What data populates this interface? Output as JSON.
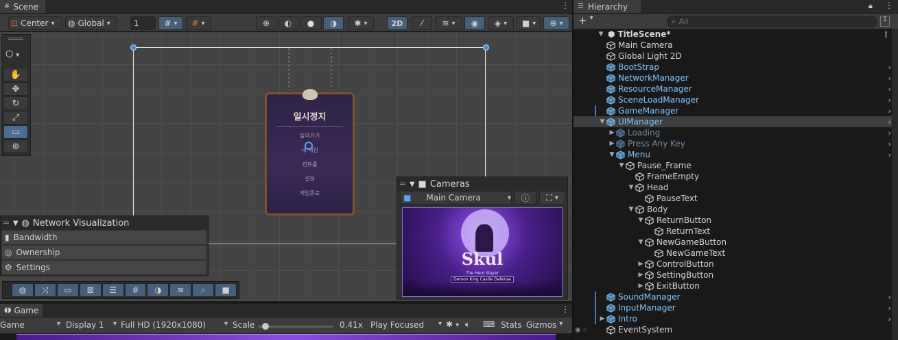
{
  "scene": {
    "tab_label": "Scene",
    "toolbar": {
      "pivot": "Center",
      "space": "Global",
      "grid_size": "1",
      "mode_2d": "2D"
    },
    "cameras_overlay": {
      "title": "Cameras",
      "selected_camera": "Main Camera"
    },
    "network_overlay": {
      "title": "Network Visualization",
      "items": [
        "Bandwidth",
        "Ownership",
        "Settings"
      ]
    },
    "pause_menu": {
      "title": "일시정지",
      "items": [
        "돌아가기",
        "새 게임",
        "컨트롤",
        "설정",
        "게임종료"
      ]
    },
    "preview": {
      "logo": "Skul",
      "subtitle": "The Hero Slayer",
      "banner": "Demon King Castle Defense"
    }
  },
  "game": {
    "tab_label": "Game",
    "view_label": "Game",
    "display": "Display 1",
    "resolution": "Full HD (1920x1080)",
    "scale_label": "Scale",
    "scale_value": "0.41x",
    "scale_fraction": 0.05,
    "play_mode": "Play Focused",
    "stats": "Stats",
    "gizmos": "Gizmos"
  },
  "hierarchy": {
    "tab_label": "Hierarchy",
    "search_placeholder": "All",
    "add_label": "+",
    "scene_name": "TitleScene*",
    "items": [
      {
        "label": "Main Camera",
        "depth": 0,
        "kind": "plain",
        "expand": "",
        "children": false
      },
      {
        "label": "Global Light 2D",
        "depth": 0,
        "kind": "plain",
        "expand": "",
        "children": false
      },
      {
        "label": "BootStrap",
        "depth": 0,
        "kind": "prefab",
        "expand": "",
        "children": true
      },
      {
        "label": "NetworkManager",
        "depth": 0,
        "kind": "prefab",
        "expand": "",
        "children": true
      },
      {
        "label": "ResourceManager",
        "depth": 0,
        "kind": "prefab",
        "expand": "",
        "children": true
      },
      {
        "label": "SceneLoadManager",
        "depth": 0,
        "kind": "prefab",
        "expand": "",
        "children": true
      },
      {
        "label": "GameManager",
        "depth": 0,
        "kind": "prefab",
        "expand": "",
        "children": true,
        "marked": true
      },
      {
        "label": "UIManager",
        "depth": 0,
        "kind": "prefab",
        "expand": "open",
        "children": true,
        "selected": true
      },
      {
        "label": "Loading",
        "depth": 1,
        "kind": "disabled",
        "expand": "closed",
        "children": true
      },
      {
        "label": "Press Any Key",
        "depth": 1,
        "kind": "disabled",
        "expand": "closed",
        "children": true
      },
      {
        "label": "Menu",
        "depth": 1,
        "kind": "prefab",
        "expand": "open",
        "children": true
      },
      {
        "label": "Pause_Frame",
        "depth": 2,
        "kind": "plain",
        "expand": "open",
        "children": false
      },
      {
        "label": "FrameEmpty",
        "depth": 3,
        "kind": "plain",
        "expand": "",
        "children": false
      },
      {
        "label": "Head",
        "depth": 3,
        "kind": "plain",
        "expand": "open",
        "children": false
      },
      {
        "label": "PauseText",
        "depth": 4,
        "kind": "plain",
        "expand": "",
        "children": false
      },
      {
        "label": "Body",
        "depth": 3,
        "kind": "plain",
        "expand": "open",
        "children": false
      },
      {
        "label": "ReturnButton",
        "depth": 4,
        "kind": "plain",
        "expand": "open",
        "children": false
      },
      {
        "label": "ReturnText",
        "depth": 5,
        "kind": "plain",
        "expand": "",
        "children": false
      },
      {
        "label": "NewGameButton",
        "depth": 4,
        "kind": "plain",
        "expand": "open",
        "children": false
      },
      {
        "label": "NewGameText",
        "depth": 5,
        "kind": "plain",
        "expand": "",
        "children": false
      },
      {
        "label": "ControlButton",
        "depth": 4,
        "kind": "plain",
        "expand": "closed",
        "children": false
      },
      {
        "label": "SettingButton",
        "depth": 4,
        "kind": "plain",
        "expand": "closed",
        "children": false
      },
      {
        "label": "ExitButton",
        "depth": 4,
        "kind": "plain",
        "expand": "closed",
        "children": false
      },
      {
        "label": "SoundManager",
        "depth": 0,
        "kind": "prefab",
        "expand": "",
        "children": true,
        "marked": true
      },
      {
        "label": "InputManager",
        "depth": 0,
        "kind": "prefab",
        "expand": "",
        "children": true,
        "marked": true
      },
      {
        "label": "Intro",
        "depth": 0,
        "kind": "prefab",
        "expand": "closed",
        "children": true,
        "marked": true
      },
      {
        "label": "EventSystem",
        "depth": 0,
        "kind": "plain",
        "expand": "",
        "children": false,
        "hidden_eye": true
      }
    ]
  },
  "colors": {
    "accent": "#4b6c94",
    "prefab_blue": "#7fc4ff",
    "menu_purple": "#3a2a55",
    "preview_purple": "#5a2a9a"
  }
}
